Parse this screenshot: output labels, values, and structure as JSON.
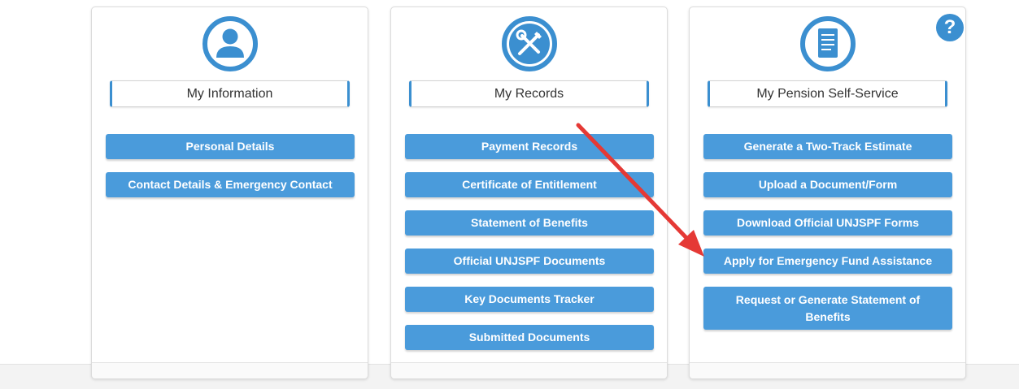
{
  "colors": {
    "accent": "#3b8fd0",
    "button": "#4a9bdb",
    "annotation_arrow": "#e53935"
  },
  "help_button": {
    "glyph": "?",
    "icon": "question-circle-icon"
  },
  "cards": [
    {
      "icon": "user-icon",
      "title": "My Information",
      "buttons": [
        "Personal Details",
        "Contact Details & Emergency Contact"
      ]
    },
    {
      "icon": "tools-icon",
      "title": "My Records",
      "buttons": [
        "Payment Records",
        "Certificate of Entitlement",
        "Statement of Benefits",
        "Official UNJSPF Documents",
        "Key Documents Tracker",
        "Submitted Documents"
      ]
    },
    {
      "icon": "document-icon",
      "title": "My Pension Self-Service",
      "buttons": [
        "Generate a Two-Track Estimate",
        "Upload a Document/Form",
        "Download Official UNJSPF Forms",
        "Apply for Emergency Fund Assistance",
        "Request or Generate Statement of Benefits"
      ]
    }
  ],
  "annotation": {
    "type": "arrow",
    "points_to": "Apply for Emergency Fund Assistance"
  }
}
